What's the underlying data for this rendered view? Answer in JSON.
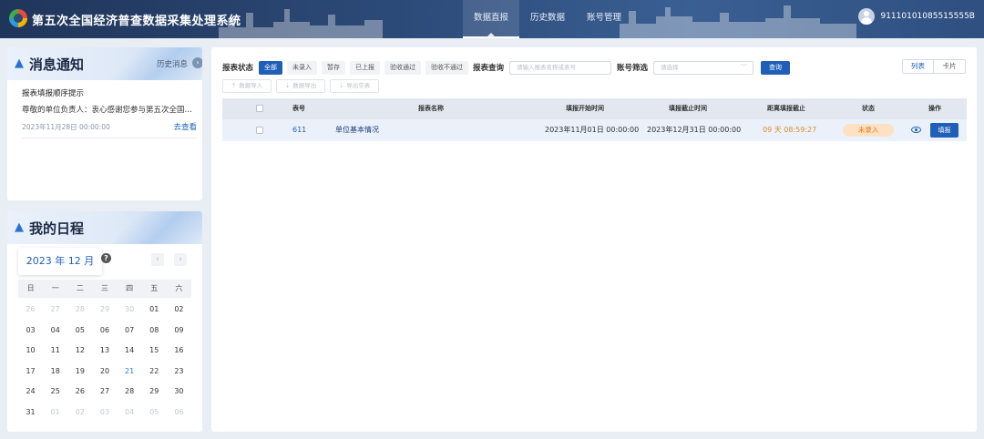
{
  "app": {
    "title": "第五次全国经济普查数据采集处理系统"
  },
  "nav": {
    "items": [
      "数据直报",
      "历史数据",
      "账号管理"
    ],
    "active_index": 0
  },
  "user": {
    "account": "91110101085515555B"
  },
  "notice": {
    "title": "消息通知",
    "history_label": "历史消息",
    "item": {
      "title": "报表填报顺序提示",
      "body": "尊敬的单位负责人：衷心感谢您参与第五次全国…",
      "date": "2023年11月28日 00:00:00",
      "link": "去查看"
    }
  },
  "schedule": {
    "title": "我的日程",
    "month_label": "2023 年 12 月",
    "help_icon": "?",
    "weekdays": [
      "日",
      "一",
      "二",
      "三",
      "四",
      "五",
      "六"
    ],
    "days": [
      {
        "d": "26",
        "s": "muted"
      },
      {
        "d": "27",
        "s": "muted"
      },
      {
        "d": "28",
        "s": "muted"
      },
      {
        "d": "29",
        "s": "muted"
      },
      {
        "d": "30",
        "s": "muted"
      },
      {
        "d": "01",
        "s": ""
      },
      {
        "d": "02",
        "s": ""
      },
      {
        "d": "03",
        "s": ""
      },
      {
        "d": "04",
        "s": ""
      },
      {
        "d": "05",
        "s": ""
      },
      {
        "d": "06",
        "s": ""
      },
      {
        "d": "07",
        "s": ""
      },
      {
        "d": "08",
        "s": ""
      },
      {
        "d": "09",
        "s": ""
      },
      {
        "d": "10",
        "s": ""
      },
      {
        "d": "11",
        "s": ""
      },
      {
        "d": "12",
        "s": ""
      },
      {
        "d": "13",
        "s": ""
      },
      {
        "d": "14",
        "s": ""
      },
      {
        "d": "15",
        "s": ""
      },
      {
        "d": "16",
        "s": ""
      },
      {
        "d": "17",
        "s": ""
      },
      {
        "d": "18",
        "s": ""
      },
      {
        "d": "19",
        "s": ""
      },
      {
        "d": "20",
        "s": ""
      },
      {
        "d": "21",
        "s": "today"
      },
      {
        "d": "22",
        "s": ""
      },
      {
        "d": "23",
        "s": ""
      },
      {
        "d": "24",
        "s": ""
      },
      {
        "d": "25",
        "s": ""
      },
      {
        "d": "26",
        "s": ""
      },
      {
        "d": "27",
        "s": ""
      },
      {
        "d": "28",
        "s": ""
      },
      {
        "d": "29",
        "s": ""
      },
      {
        "d": "30",
        "s": ""
      },
      {
        "d": "31",
        "s": ""
      },
      {
        "d": "01",
        "s": "muted"
      },
      {
        "d": "02",
        "s": "muted"
      },
      {
        "d": "03",
        "s": "muted"
      },
      {
        "d": "04",
        "s": "muted"
      },
      {
        "d": "05",
        "s": "muted"
      },
      {
        "d": "06",
        "s": "muted"
      }
    ]
  },
  "filters": {
    "status_label": "报表状态",
    "status_chips": [
      "全部",
      "未录入",
      "暂存",
      "已上报",
      "验收通过",
      "验收不通过"
    ],
    "active_chip": 0,
    "query_label": "报表查询",
    "query_placeholder": "请输入报表名称或表号",
    "account_label": "账号筛选",
    "account_placeholder": "请选择",
    "search_button": "查询"
  },
  "view_toggle": {
    "list": "列表",
    "card": "卡片"
  },
  "actions": {
    "import": "数据导入",
    "export": "数据导出",
    "export_empty": "导出空表"
  },
  "table": {
    "headers": {
      "code": "表号",
      "name": "报表名称",
      "start": "填报开始时间",
      "end": "填报截止时间",
      "remaining": "距离填报截止",
      "status": "状态",
      "ops": "操作"
    },
    "rows": [
      {
        "code": "611",
        "name": "单位基本情况",
        "start": "2023年11月01日 00:00:00",
        "end": "2023年12月31日 00:00:00",
        "remaining": "09 天 08:59:27",
        "status": "未录入",
        "op": "填报"
      }
    ]
  },
  "colors": {
    "primary": "#1f5fb8",
    "header_bg": "#2c4a78",
    "warning": "#e07b18"
  },
  "icons": [
    "logo-icon",
    "user-avatar-icon",
    "bell-icon",
    "calendar-icon",
    "chevron-right-icon",
    "eye-icon",
    "upload-icon",
    "download-icon"
  ]
}
